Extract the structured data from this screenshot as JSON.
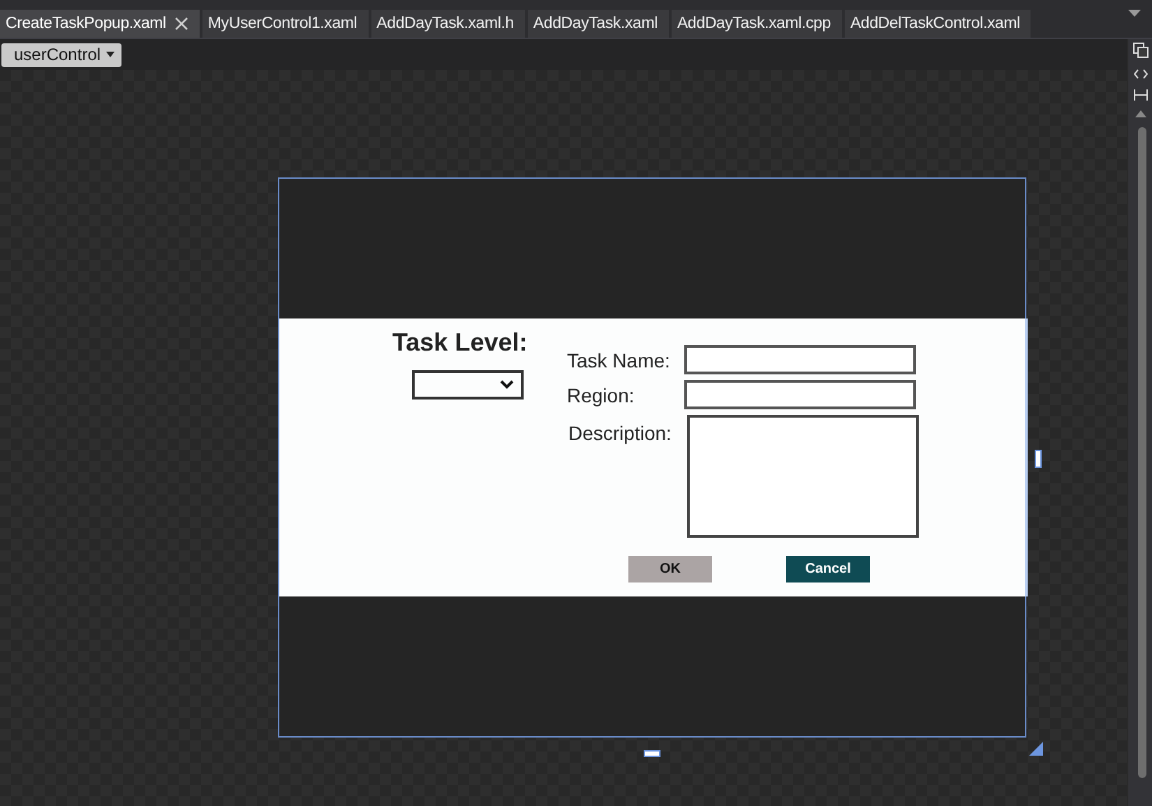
{
  "tabs": [
    {
      "label": "CreateTaskPopup.xaml",
      "selected": true,
      "closable": true
    },
    {
      "label": "MyUserControl1.xaml",
      "selected": false,
      "closable": false
    },
    {
      "label": "AddDayTask.xaml.h",
      "selected": false,
      "closable": false
    },
    {
      "label": "AddDayTask.xaml",
      "selected": false,
      "closable": false
    },
    {
      "label": "AddDayTask.xaml.cpp",
      "selected": false,
      "closable": false
    },
    {
      "label": "AddDelTaskControl.xaml",
      "selected": false,
      "closable": false
    }
  ],
  "scope_dropdown": {
    "label": "userControl"
  },
  "form": {
    "title": "Task Level:",
    "fields": [
      {
        "label": "Task Name:",
        "kind": "line"
      },
      {
        "label": "Region:",
        "kind": "line"
      },
      {
        "label": "Description:",
        "kind": "area"
      }
    ],
    "buttons": [
      {
        "label": "OK",
        "kind": "secondary"
      },
      {
        "label": "Cancel",
        "kind": "primary"
      }
    ]
  }
}
